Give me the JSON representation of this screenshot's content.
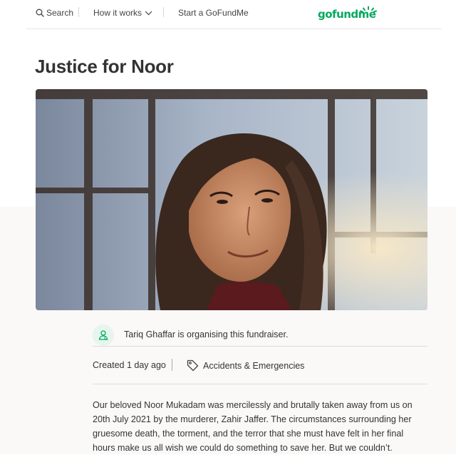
{
  "header": {
    "search_label": "Search",
    "how_it_works_label": "How it works",
    "start_label": "Start a GoFundMe",
    "logo_text": "gofundme"
  },
  "campaign": {
    "title": "Justice for Noor",
    "photo_subject": "Portrait of a smiling woman with long dark hair by a window",
    "organiser_text": "Tariq Ghaffar is organising this fundraiser.",
    "created_text": "Created 1 day ago",
    "category_label": "Accidents & Emergencies",
    "story": "Our beloved Noor Mukadam was mercilessly and brutally taken away from us on 20th July 2021 by the murderer, Zahir Jaffer. The circumstances surrounding her gruesome death, the torment, and the terror that she must have felt in her final hours make us all wish we could do something to save her. But we couldn’t."
  },
  "colors": {
    "brand_green": "#02a95c",
    "text": "#333333",
    "lower_background": "#faf9f8"
  },
  "icons": [
    "search-icon",
    "chevron-down-icon",
    "organiser-icon",
    "tag-icon"
  ]
}
